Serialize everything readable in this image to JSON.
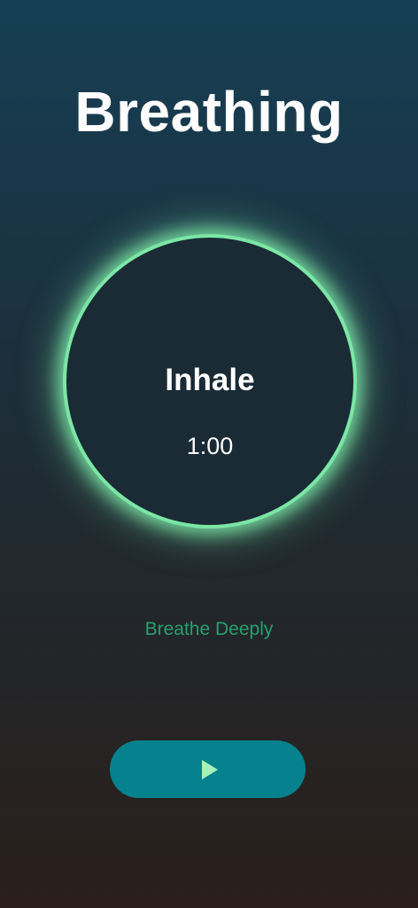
{
  "header": {
    "title": "Breathing"
  },
  "breath_circle": {
    "phase_label": "Inhale",
    "timer": "1:00",
    "glow_color": "#7be6a6"
  },
  "hint": {
    "text": "Breathe Deeply",
    "color": "#25a06e"
  },
  "controls": {
    "play_icon": "play-icon",
    "button_color": "#06818e"
  }
}
